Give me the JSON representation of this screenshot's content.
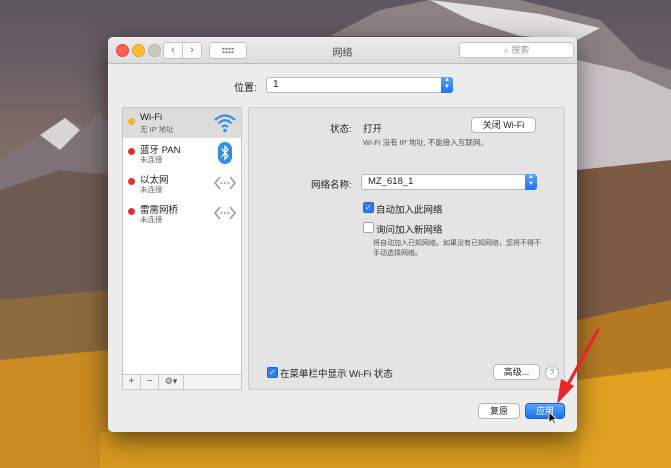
{
  "window": {
    "title": "网络",
    "search_placeholder": "搜索",
    "nav_back": "‹",
    "nav_forward": "›"
  },
  "location": {
    "label": "位置:",
    "value": "1"
  },
  "services": [
    {
      "name": "Wi-Fi",
      "status": "无 IP 地址",
      "dot_color": "#f3b52a",
      "icon": "wifi-icon",
      "selected": true
    },
    {
      "name": "蓝牙 PAN",
      "status": "未连接",
      "dot_color": "#e0332d",
      "icon": "bluetooth-icon",
      "selected": false
    },
    {
      "name": "以太网",
      "status": "未连接",
      "dot_color": "#e0332d",
      "icon": "ethernet-arrows-icon",
      "selected": false
    },
    {
      "name": "雷雳网桥",
      "status": "未连接",
      "dot_color": "#e0332d",
      "icon": "ethernet-arrows-icon",
      "selected": false
    }
  ],
  "service_toolbar": {
    "add": "+",
    "remove": "−",
    "action": "⚙▾"
  },
  "detail": {
    "status_label": "状态:",
    "status_value": "打开",
    "status_description": "Wi-Fi 没有 IP 地址, 不能接入互联网。",
    "wifi_off_button": "关闭 Wi-Fi",
    "network_name_label": "网络名称:",
    "network_name_value": "MZ_618_1",
    "auto_join_label": "自动加入此网络",
    "auto_join_checked": true,
    "ask_join_label": "询问加入新网络",
    "ask_join_checked": false,
    "ask_join_note": "将自动加入已知网络。如果没有已知网络，您将不得不手动选择网络。",
    "show_menu_label": "在菜单栏中显示 Wi-Fi 状态",
    "show_menu_checked": true,
    "advanced_button": "高级...",
    "help_button": "?"
  },
  "footer": {
    "revert_button": "复原",
    "apply_button": "应用"
  },
  "colors": {
    "accent_blue": "#2f7bf2",
    "status_yellow": "#f3b52a",
    "status_red": "#e0332d",
    "annotation_red": "#e8262a"
  }
}
